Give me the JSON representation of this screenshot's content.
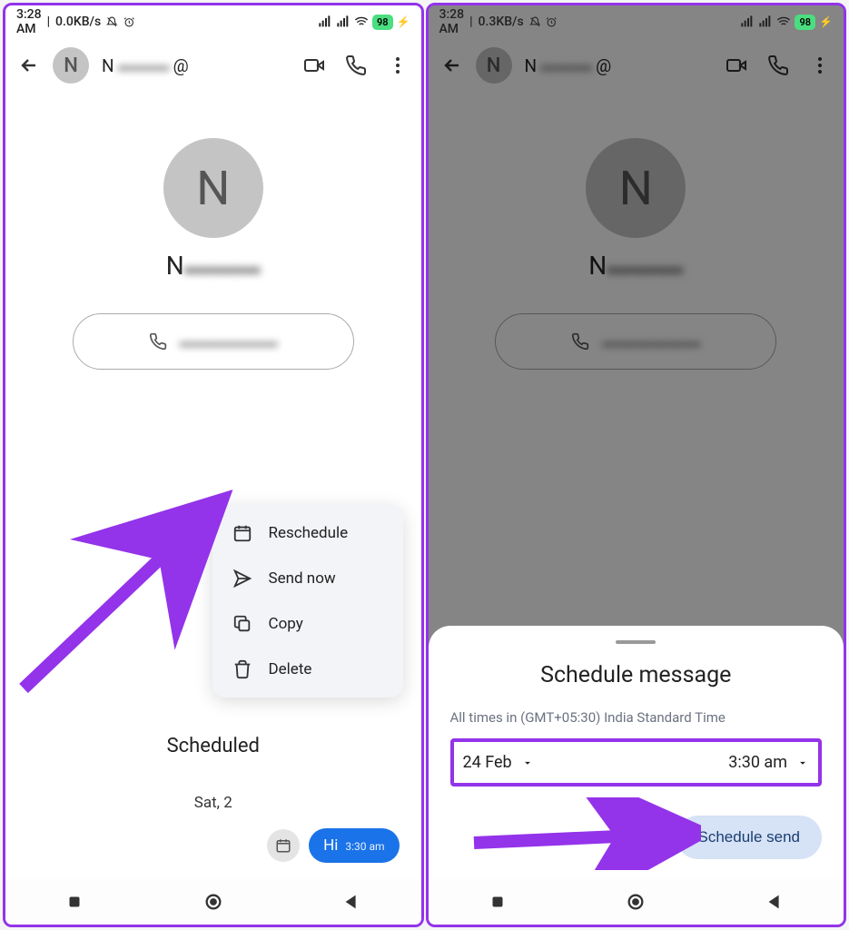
{
  "status": {
    "time_left": "3:28 AM",
    "data_left": "0.0KB/s",
    "data_right": "0.3KB/s",
    "battery": "98"
  },
  "header": {
    "avatar_letter": "N",
    "name_initial": "N",
    "name_blur": "▬▬▬",
    "at": "@"
  },
  "profile": {
    "avatar_letter": "N",
    "name_initial": "N",
    "name_blur": "▬▬▬",
    "phone_blur": "▬▬▬▬▬▬"
  },
  "sheet1": {
    "title": "Scheduled",
    "date": "Sat, 2",
    "msg_text": "Hi",
    "msg_time": "3:30 am"
  },
  "ctx": {
    "reschedule": "Reschedule",
    "send_now": "Send now",
    "copy": "Copy",
    "delete": "Delete"
  },
  "sheet2": {
    "title": "Schedule message",
    "tz": "All times in (GMT+05:30) India Standard Time",
    "date": "24 Feb",
    "time": "3:30 am",
    "btn": "Schedule send"
  }
}
